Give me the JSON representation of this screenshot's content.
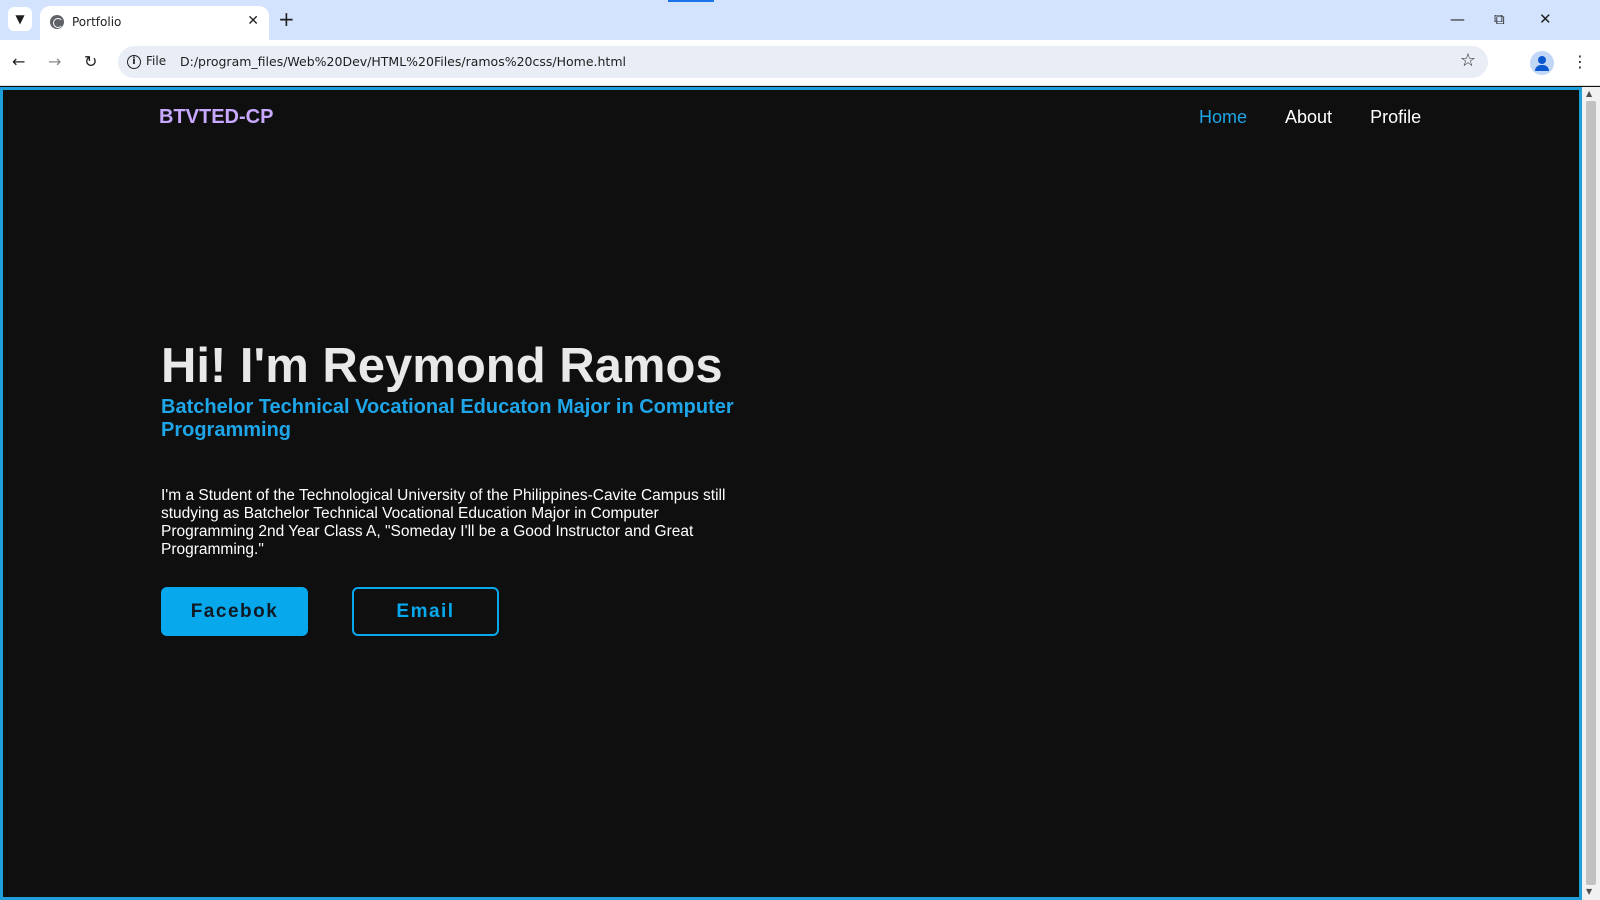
{
  "browser": {
    "tab_title": "Portfolio",
    "chip": "File",
    "url": "D:/program_files/Web%20Dev/HTML%20Files/ramos%20css/Home.html"
  },
  "site": {
    "brand": "BTVTED-CP",
    "nav": [
      "Home",
      "About",
      "Profile"
    ],
    "active_nav": "Home",
    "accent_color": "#1ea6e8",
    "brand_color": "#c8a9ff",
    "background": "#0f0f10"
  },
  "hero": {
    "title": "Hi! I'm Reymond Ramos",
    "subtitle": "Batchelor Technical Vocational Educaton Major in Computer Programming",
    "description": "I'm a Student of the Technological University of the Philippines-Cavite Campus still studying as Batchelor Technical Vocational Education Major in Computer Programming 2nd Year Class A, \"Someday I'll be a Good Instructor and Great Programming.\"",
    "facebook_label": "Facebok",
    "email_label": "Email"
  }
}
